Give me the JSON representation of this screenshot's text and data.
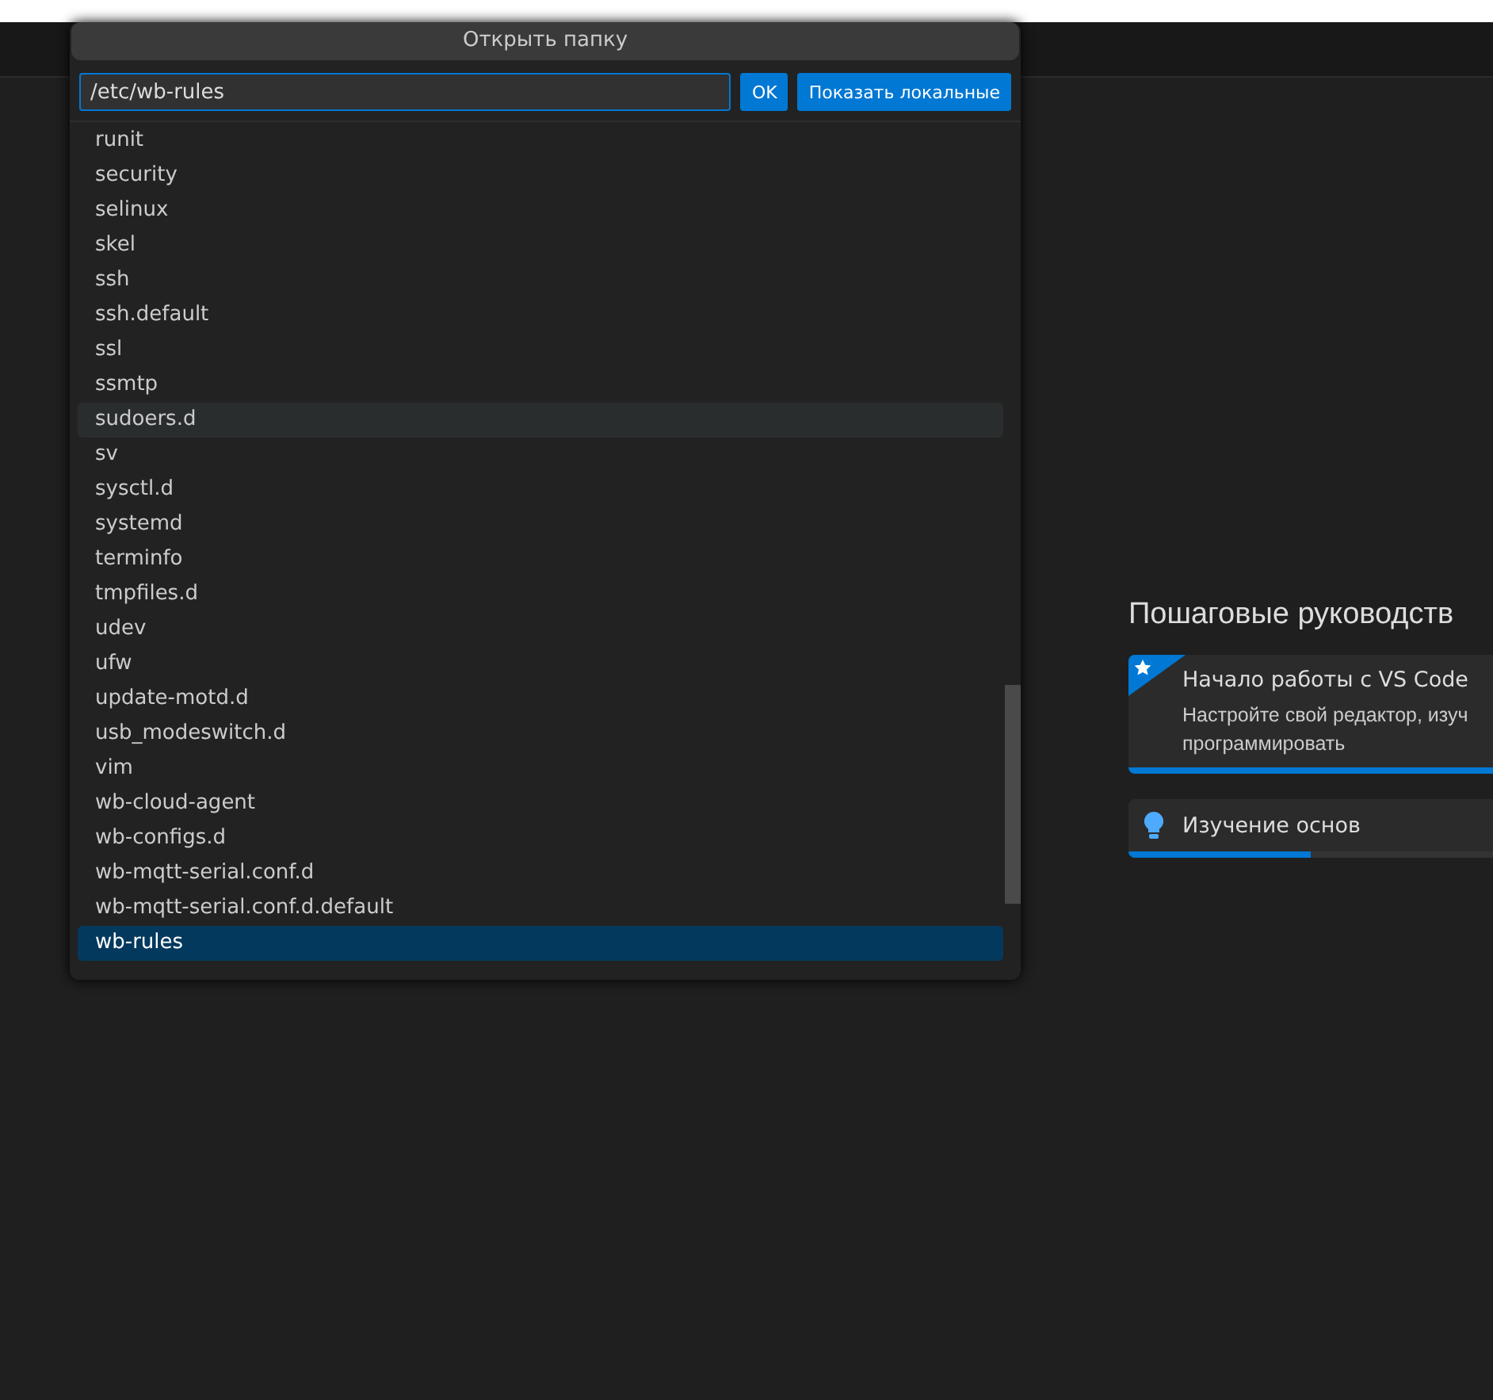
{
  "dialog": {
    "title": "Открыть папку",
    "path_value": "/etc/wb-rules",
    "ok_button": "OK",
    "local_button": "Показать локальные",
    "items": [
      {
        "label": "runit",
        "selected": false,
        "hovered": false
      },
      {
        "label": "security",
        "selected": false,
        "hovered": false
      },
      {
        "label": "selinux",
        "selected": false,
        "hovered": false
      },
      {
        "label": "skel",
        "selected": false,
        "hovered": false
      },
      {
        "label": "ssh",
        "selected": false,
        "hovered": false
      },
      {
        "label": "ssh.default",
        "selected": false,
        "hovered": false
      },
      {
        "label": "ssl",
        "selected": false,
        "hovered": false
      },
      {
        "label": "ssmtp",
        "selected": false,
        "hovered": false
      },
      {
        "label": "sudoers.d",
        "selected": false,
        "hovered": true
      },
      {
        "label": "sv",
        "selected": false,
        "hovered": false
      },
      {
        "label": "sysctl.d",
        "selected": false,
        "hovered": false
      },
      {
        "label": "systemd",
        "selected": false,
        "hovered": false
      },
      {
        "label": "terminfo",
        "selected": false,
        "hovered": false
      },
      {
        "label": "tmpfiles.d",
        "selected": false,
        "hovered": false
      },
      {
        "label": "udev",
        "selected": false,
        "hovered": false
      },
      {
        "label": "ufw",
        "selected": false,
        "hovered": false
      },
      {
        "label": "update-motd.d",
        "selected": false,
        "hovered": false
      },
      {
        "label": "usb_modeswitch.d",
        "selected": false,
        "hovered": false
      },
      {
        "label": "vim",
        "selected": false,
        "hovered": false
      },
      {
        "label": "wb-cloud-agent",
        "selected": false,
        "hovered": false
      },
      {
        "label": "wb-configs.d",
        "selected": false,
        "hovered": false
      },
      {
        "label": "wb-mqtt-serial.conf.d",
        "selected": false,
        "hovered": false
      },
      {
        "label": "wb-mqtt-serial.conf.d.default",
        "selected": false,
        "hovered": false
      },
      {
        "label": "wb-rules",
        "selected": true,
        "hovered": false
      }
    ]
  },
  "walkthroughs": {
    "heading": "Пошаговые руководств",
    "cards": [
      {
        "kind": "featured",
        "title": "Начало работы с VS Code",
        "description": [
          "Настройте свой редактор, изуч",
          "программировать"
        ],
        "level": 1
      },
      {
        "kind": "basic",
        "title": "Изучение основ",
        "level": 0.5
      }
    ]
  }
}
